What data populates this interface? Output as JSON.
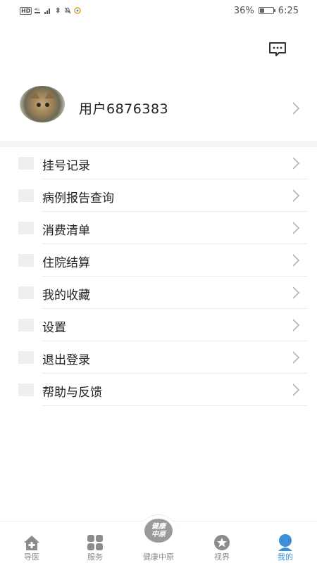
{
  "status_bar": {
    "left_hd": "HD",
    "battery_percent": "36%",
    "battery_level": 0.36,
    "time": "6:25"
  },
  "profile": {
    "username": "用户6876383"
  },
  "menu": {
    "items": [
      {
        "label": "挂号记录"
      },
      {
        "label": "病例报告查询"
      },
      {
        "label": "消费清单"
      },
      {
        "label": "住院结算"
      },
      {
        "label": "我的收藏"
      },
      {
        "label": "设置"
      },
      {
        "label": "退出登录"
      },
      {
        "label": "帮助与反馈"
      }
    ]
  },
  "tabbar": {
    "tabs": [
      {
        "label": "导医",
        "icon": "home-plus-icon"
      },
      {
        "label": "服务",
        "icon": "grid-icon"
      },
      {
        "label": "健康中原",
        "icon": "health-logo-icon",
        "logo_line1": "健康",
        "logo_line2": "中原"
      },
      {
        "label": "视界",
        "icon": "star-icon"
      },
      {
        "label": "我的",
        "icon": "person-icon"
      }
    ],
    "active_index": 4,
    "active_color": "#3d8fd9",
    "inactive_color": "#8c8c8c"
  }
}
